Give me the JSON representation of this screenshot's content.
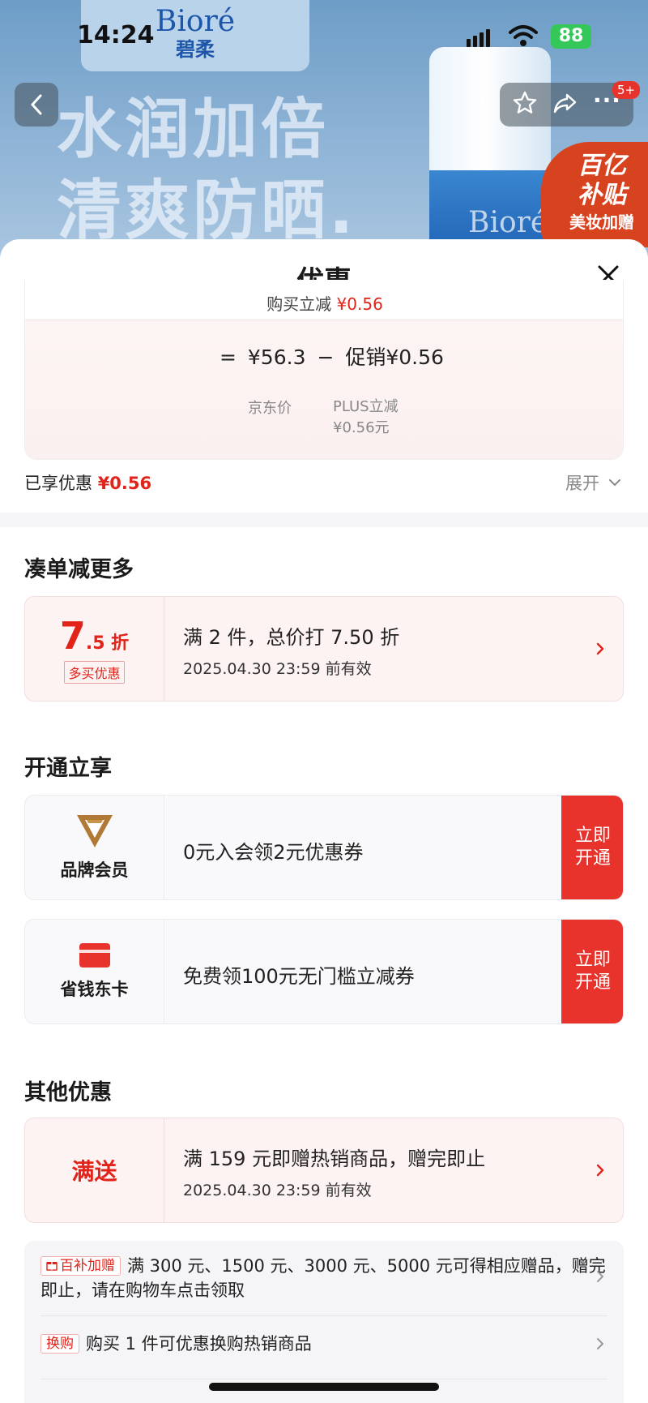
{
  "banner": {
    "brand_en": "Bioré",
    "brand_cn": "碧柔",
    "headline_1": "水润加倍",
    "headline_2": "清爽防晒.",
    "bottle_text": "Bioré",
    "badge_line1": "百亿",
    "badge_line2": "补贴",
    "badge_line3": "美妆加赠"
  },
  "status_bar": {
    "time": "14:24",
    "battery": "88"
  },
  "nav": {
    "message_badge": "5+"
  },
  "sheet": {
    "title": "优惠",
    "calc": {
      "top_text": "购买立减",
      "top_amount": "¥0.56",
      "equals": "=",
      "jd_price": "¥56.3",
      "minus": "−",
      "promo": "促销¥0.56",
      "jd_price_label": "京东价",
      "plus_label": "PLUS立减",
      "plus_amount": "¥0.56元"
    },
    "enjoyed_label": "已享优惠",
    "enjoyed_amount": "¥0.56",
    "expand_label": "展开"
  },
  "section_more": {
    "title": "凑单减更多",
    "offer": {
      "discount_number": "7",
      "discount_suffix": ".5 折",
      "tag": "多买优惠",
      "main": "满 2 件，总价打 7.50 折",
      "validity": "2025.04.30 23:59 前有效"
    }
  },
  "section_open": {
    "title": "开通立享",
    "items": [
      {
        "label": "品牌会员",
        "text": "0元入会领2元优惠券",
        "button": "立即开通"
      },
      {
        "label": "省钱东卡",
        "text": "免费领100元无门槛立减券",
        "button": "立即开通"
      }
    ]
  },
  "section_other": {
    "title": "其他优惠",
    "offer": {
      "label": "满送",
      "main": "满 159 元即赠热销商品，赠完即止",
      "validity": "2025.04.30 23:59 前有效"
    },
    "list": [
      {
        "tag": "百补加赠",
        "text": "满 300 元、1500 元、3000 元、5000 元可得相应赠品，赠完即止，请在购物车点击领取"
      },
      {
        "tag": "换购",
        "text": "购买 1 件可优惠换购热销商品"
      }
    ]
  },
  "colors": {
    "accent_red": "#e8322c",
    "price_red": "#e2231a"
  }
}
